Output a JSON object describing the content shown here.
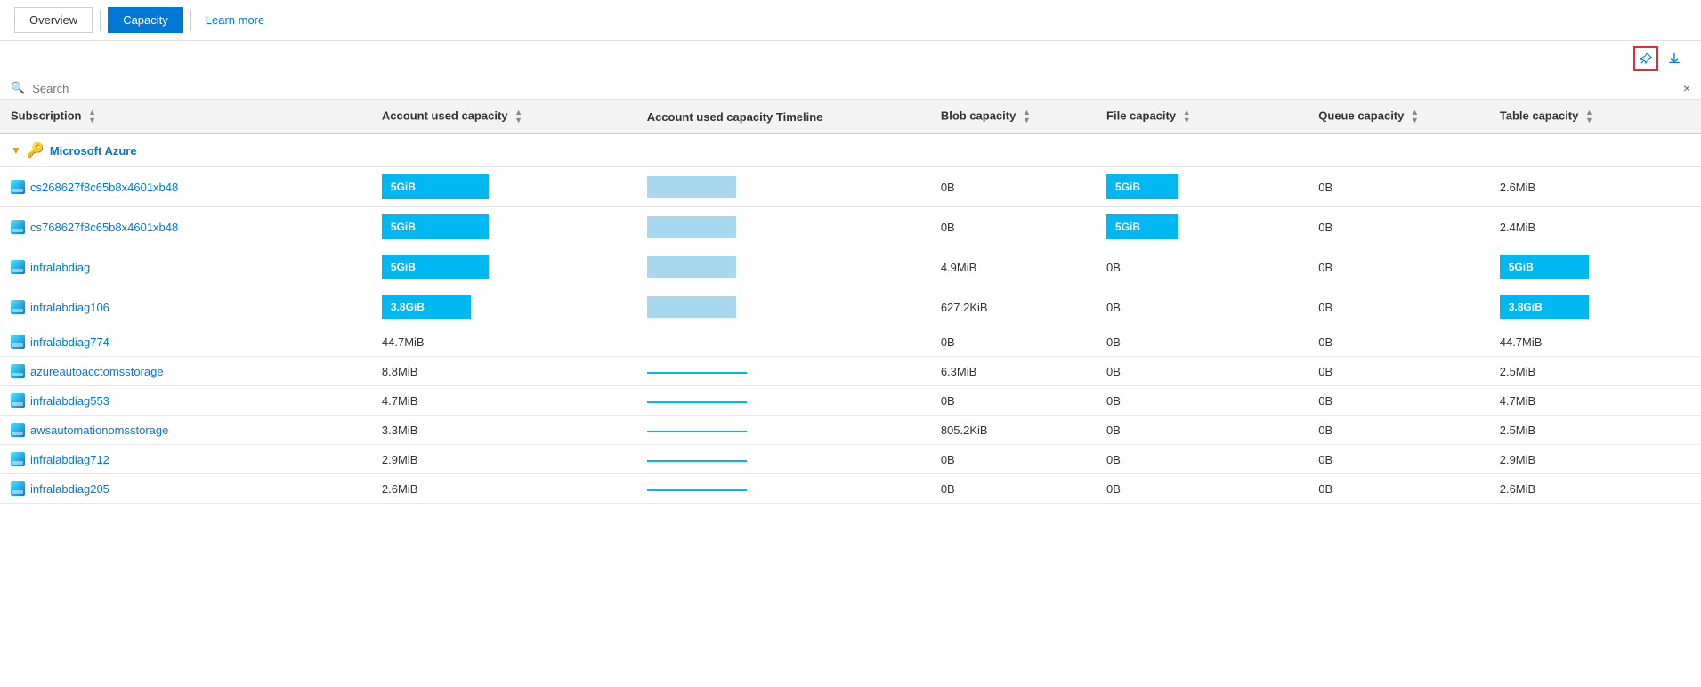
{
  "nav": {
    "overview_label": "Overview",
    "capacity_label": "Capacity",
    "learn_more_label": "Learn more"
  },
  "toolbar": {
    "pin_label": "Pin",
    "download_label": "Download"
  },
  "search": {
    "placeholder": "Search",
    "clear_label": "×"
  },
  "table": {
    "columns": [
      {
        "key": "subscription",
        "label": "Subscription"
      },
      {
        "key": "account_used_capacity",
        "label": "Account used capacity"
      },
      {
        "key": "account_used_capacity_timeline",
        "label": "Account used capacity Timeline"
      },
      {
        "key": "blob_capacity",
        "label": "Blob capacity"
      },
      {
        "key": "file_capacity",
        "label": "File capacity"
      },
      {
        "key": "queue_capacity",
        "label": "Queue capacity"
      },
      {
        "key": "table_capacity",
        "label": "Table capacity"
      }
    ],
    "group": {
      "name": "Microsoft Azure"
    },
    "rows": [
      {
        "subscription": "cs268627f8c65b8x4601xb48",
        "account_used_capacity": "5GiB",
        "account_used_capacity_bar": true,
        "account_used_capacity_timeline_bar": true,
        "blob_capacity": "0B",
        "file_capacity": "5GiB",
        "file_capacity_bar": true,
        "queue_capacity": "0B",
        "table_capacity": "2.6MiB"
      },
      {
        "subscription": "cs768627f8c65b8x4601xb48",
        "account_used_capacity": "5GiB",
        "account_used_capacity_bar": true,
        "account_used_capacity_timeline_bar": true,
        "blob_capacity": "0B",
        "file_capacity": "5GiB",
        "file_capacity_bar": true,
        "queue_capacity": "0B",
        "table_capacity": "2.4MiB"
      },
      {
        "subscription": "infralabdiag",
        "account_used_capacity": "5GiB",
        "account_used_capacity_bar": true,
        "account_used_capacity_timeline_bar": true,
        "blob_capacity": "4.9MiB",
        "file_capacity": "0B",
        "file_capacity_bar": false,
        "queue_capacity": "0B",
        "table_capacity": "5GiB",
        "table_capacity_bar": true
      },
      {
        "subscription": "infralabdiag106",
        "account_used_capacity": "3.8GiB",
        "account_used_capacity_bar": true,
        "account_used_capacity_bar_medium": true,
        "account_used_capacity_timeline_bar": true,
        "blob_capacity": "627.2KiB",
        "file_capacity": "0B",
        "file_capacity_bar": false,
        "queue_capacity": "0B",
        "table_capacity": "3.8GiB",
        "table_capacity_bar": true
      },
      {
        "subscription": "infralabdiag774",
        "account_used_capacity": "44.7MiB",
        "account_used_capacity_bar": false,
        "account_used_capacity_timeline_bar": false,
        "blob_capacity": "0B",
        "file_capacity": "0B",
        "file_capacity_bar": false,
        "queue_capacity": "0B",
        "table_capacity": "44.7MiB"
      },
      {
        "subscription": "azureautoacctomsstorage",
        "account_used_capacity": "8.8MiB",
        "account_used_capacity_bar": false,
        "account_used_capacity_timeline_bar": true,
        "account_used_capacity_timeline_style": "line",
        "blob_capacity": "6.3MiB",
        "file_capacity": "0B",
        "file_capacity_bar": false,
        "queue_capacity": "0B",
        "table_capacity": "2.5MiB"
      },
      {
        "subscription": "infralabdiag553",
        "account_used_capacity": "4.7MiB",
        "account_used_capacity_bar": false,
        "account_used_capacity_timeline_bar": true,
        "account_used_capacity_timeline_style": "line",
        "blob_capacity": "0B",
        "file_capacity": "0B",
        "file_capacity_bar": false,
        "queue_capacity": "0B",
        "table_capacity": "4.7MiB"
      },
      {
        "subscription": "awsautomationomsstorage",
        "account_used_capacity": "3.3MiB",
        "account_used_capacity_bar": false,
        "account_used_capacity_timeline_bar": true,
        "account_used_capacity_timeline_style": "line",
        "blob_capacity": "805.2KiB",
        "file_capacity": "0B",
        "file_capacity_bar": false,
        "queue_capacity": "0B",
        "table_capacity": "2.5MiB"
      },
      {
        "subscription": "infralabdiag712",
        "account_used_capacity": "2.9MiB",
        "account_used_capacity_bar": false,
        "account_used_capacity_timeline_bar": true,
        "account_used_capacity_timeline_style": "line",
        "blob_capacity": "0B",
        "file_capacity": "0B",
        "file_capacity_bar": false,
        "queue_capacity": "0B",
        "table_capacity": "2.9MiB"
      },
      {
        "subscription": "infralabdiag205",
        "account_used_capacity": "2.6MiB",
        "account_used_capacity_bar": false,
        "account_used_capacity_timeline_bar": true,
        "account_used_capacity_timeline_style": "line",
        "blob_capacity": "0B",
        "file_capacity": "0B",
        "file_capacity_bar": false,
        "queue_capacity": "0B",
        "table_capacity": "2.6MiB"
      }
    ]
  }
}
